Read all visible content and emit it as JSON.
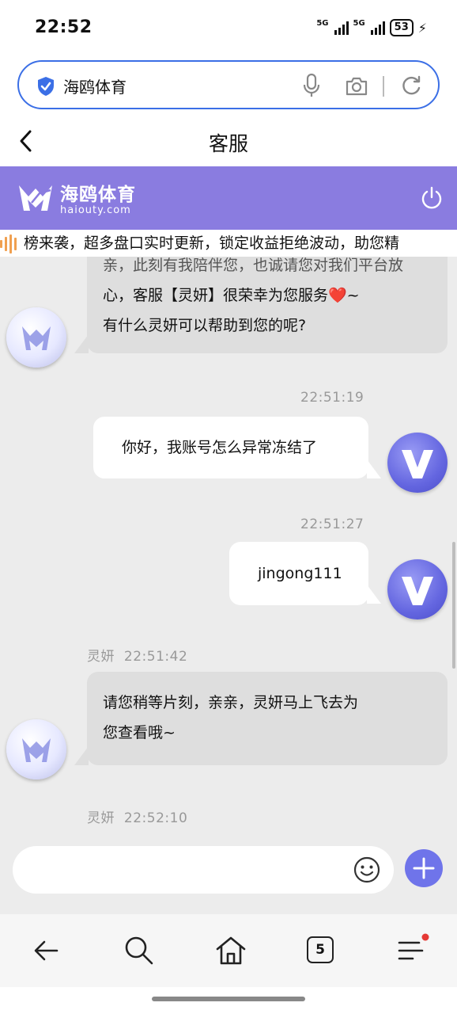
{
  "status_bar": {
    "time": "22:52",
    "sim1_label": "5G",
    "sim2_label": "5G",
    "battery": "53"
  },
  "address_bar": {
    "text": "海鸥体育",
    "icons": [
      "shield-check-icon",
      "mic-icon",
      "camera-icon",
      "refresh-icon"
    ]
  },
  "header": {
    "title": "客服",
    "back_icon": "chevron-left-icon"
  },
  "brand": {
    "name": "海鸥体育",
    "domain": "haiouty.com",
    "color": "#8a7ce0"
  },
  "marquee": {
    "text": "榜来袭，超多盘口实时更新，锁定收益拒绝波动，助您精"
  },
  "chat": {
    "messages": [
      {
        "side": "left",
        "sender": "",
        "time": "",
        "lines": [
          "亲，此刻有我陪伴您，也诚请您对我们平台放心，客服【灵妍】很荣幸为您服务",
          "心，客服【灵妍】很荣幸为您服务❤️~",
          "有什么灵妍可以帮助到您的呢?"
        ]
      },
      {
        "side": "right",
        "time": "22:51:19",
        "text": "你好，我账号怎么异常冻结了"
      },
      {
        "side": "right",
        "time": "22:51:27",
        "text": "jingong111"
      },
      {
        "side": "left",
        "sender": "灵妍",
        "time": "22:51:42",
        "lines": [
          "请您稍等片刻，亲亲，灵妍马上飞去为",
          "您查看哦~"
        ]
      },
      {
        "side": "left",
        "sender": "灵妍",
        "time": "22:52:10",
        "lines": []
      }
    ]
  },
  "input": {
    "placeholder": ""
  },
  "bottom_nav": {
    "tab_count": "5",
    "accent": "#e53935"
  }
}
